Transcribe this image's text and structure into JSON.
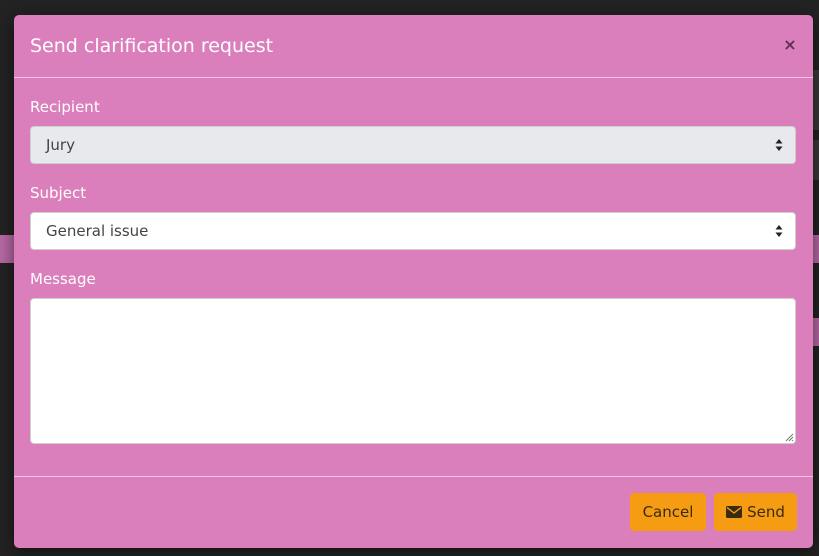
{
  "modal": {
    "title": "Send clarification request",
    "close_glyph": "×"
  },
  "form": {
    "recipient_label": "Recipient",
    "recipient_value": "Jury",
    "subject_label": "Subject",
    "subject_value": "General issue",
    "message_label": "Message",
    "message_value": ""
  },
  "footer": {
    "cancel_label": "Cancel",
    "send_label": "Send",
    "send_icon": "envelope-icon"
  },
  "colors": {
    "modal_bg": "#db7fbc",
    "button_bg": "#f59c12",
    "disabled_select_bg": "#e8e9ec"
  }
}
